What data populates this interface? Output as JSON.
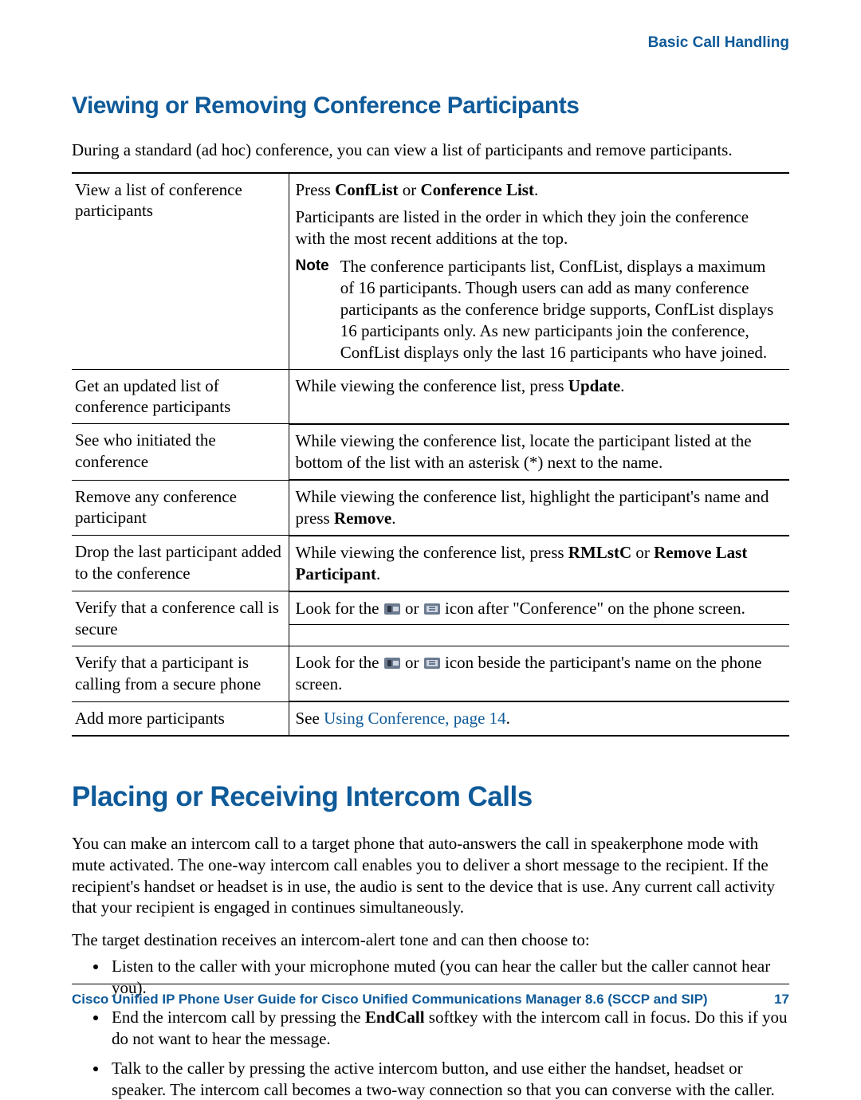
{
  "header": {
    "section": "Basic Call Handling"
  },
  "section1": {
    "heading": "Viewing or Removing Conference Participants",
    "intro": "During a standard (ad hoc) conference, you can view a list of participants and remove participants."
  },
  "table": {
    "rows": [
      {
        "left": "View a list of conference participants",
        "para1_pre": "Press ",
        "para1_b1": "ConfList",
        "para1_mid": " or ",
        "para1_b2": "Conference List",
        "para1_post": ".",
        "para2": "Participants are listed in the order in which they join the conference with the most recent additions at the top.",
        "note_label": "Note",
        "note_body": "The conference participants list, ConfList, displays a maximum of 16 participants. Though users can add as many conference participants as the conference bridge supports, ConfList displays 16 participants only. As new participants join the conference, ConfList displays only the last 16 participants who have joined."
      },
      {
        "left": "Get an updated list of conference participants",
        "pre": "While viewing the conference list, press ",
        "b1": "Update",
        "post": "."
      },
      {
        "left": "See who initiated the conference",
        "text": "While viewing the conference list, locate the participant listed at the bottom of the list with an asterisk (*) next to the name."
      },
      {
        "left": "Remove any conference participant",
        "pre": "While viewing the conference list, highlight the participant's name and press ",
        "b1": "Remove",
        "post": "."
      },
      {
        "left": "Drop the last participant added to the conference",
        "pre": "While viewing the conference list, press ",
        "b1": "RMLstC",
        "mid": " or ",
        "b2": "Remove Last Participant",
        "post": "."
      },
      {
        "left": "Verify that a conference call is secure",
        "pre": "Look for the ",
        "mid": " or ",
        "post": " icon after \"Conference\" on the phone screen."
      },
      {
        "left": "Verify that a participant is calling from a secure phone",
        "pre": "Look for the ",
        "mid": " or ",
        "post": " icon beside the participant's name on the phone screen."
      },
      {
        "left": "Add more participants",
        "pre": "See ",
        "link": "Using Conference, page 14",
        "post": "."
      }
    ]
  },
  "section2": {
    "heading": "Placing or Receiving Intercom Calls",
    "para1": "You can make an intercom call to a target phone that auto-answers the call in speakerphone mode with mute activated. The one-way intercom call enables you to deliver a short message to the recipient. If the recipient's handset or headset is in use, the audio is sent to the device that is use. Any current call activity that your recipient is engaged in continues simultaneously.",
    "para2": "The target destination receives an intercom-alert tone and can then choose to:",
    "bullets": [
      "Listen to the caller with your microphone muted (you can hear the caller but the caller cannot hear you).",
      {
        "pre": "End the intercom call by pressing the ",
        "b": "EndCall",
        "post": " softkey with the intercom call in focus. Do this if you do not want to hear the message."
      },
      "Talk to the caller by pressing the active intercom button, and use either the handset, headset or speaker. The intercom call becomes a two-way connection so that you can converse with the caller."
    ]
  },
  "footer": {
    "title": "Cisco Unified IP Phone User Guide for Cisco Unified Communications Manager 8.6 (SCCP and SIP)",
    "page": "17"
  }
}
